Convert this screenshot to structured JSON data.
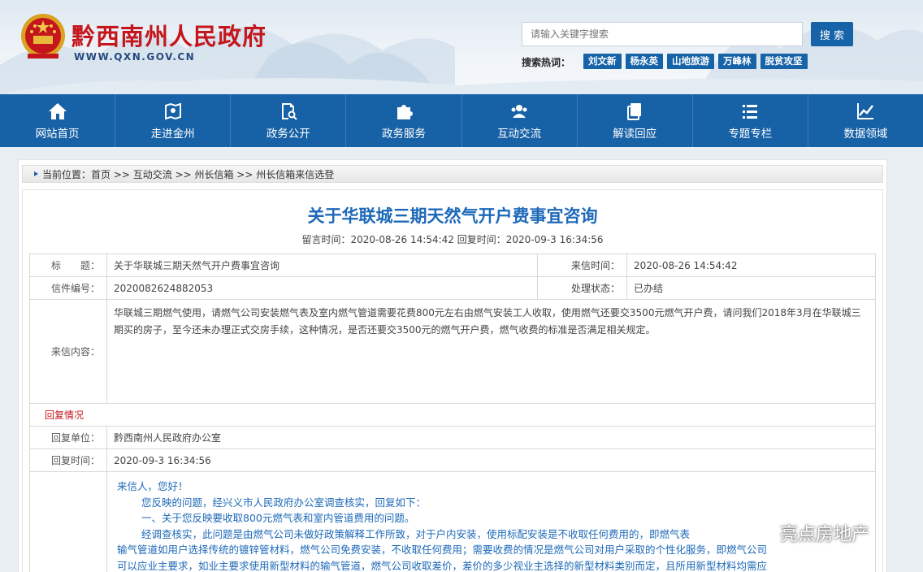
{
  "header": {
    "site_name": "黔西南州人民政府",
    "site_url": "WWW.QXN.GOV.CN",
    "search_placeholder": "请输入关键字搜索",
    "search_button": "搜 索",
    "hot_label": "搜索热词：",
    "hot_tags": [
      "刘文新",
      "杨永英",
      "山地旅游",
      "万峰林",
      "脱贫攻坚"
    ]
  },
  "nav": [
    {
      "label": "网站首页",
      "icon": "home-icon"
    },
    {
      "label": "走进金州",
      "icon": "map-pin-icon"
    },
    {
      "label": "政务公开",
      "icon": "document-search-icon"
    },
    {
      "label": "政务服务",
      "icon": "puzzle-icon"
    },
    {
      "label": "互动交流",
      "icon": "users-icon"
    },
    {
      "label": "解读回应",
      "icon": "copy-icon"
    },
    {
      "label": "专题专栏",
      "icon": "list-icon"
    },
    {
      "label": "数据领域",
      "icon": "chart-icon"
    }
  ],
  "breadcrumb": {
    "prefix": "当前位置：",
    "path": "首页 >> 互动交流 >> 州长信箱 >> 州长信箱来信选登"
  },
  "letter": {
    "title": "关于华联城三期天然气开户费事宜咨询",
    "meta": "留言时间：2020-08-26 14:54:42 回复时间：2020-09-3 16:34:56",
    "rows": {
      "title_label": "标　　题：",
      "title_value": "关于华联城三期天然气开户费事宜咨询",
      "recv_time_label": "来信时间：",
      "recv_time_value": "2020-08-26 14:54:42",
      "number_label": "信件编号：",
      "number_value": "2020082624882053",
      "status_label": "处理状态：",
      "status_value": "已办结",
      "content_label": "来信内容：",
      "content_value": "华联城三期燃气使用，请燃气公司安装燃气表及室内燃气管道需要花费800元左右由燃气安装工人收取，使用燃气还要交3500元燃气开户费，请问我们2018年3月在华联城三期买的房子，至今还未办理正式交房手续，这种情况，是否还要交3500元的燃气开户费，燃气收费的标准是否满足相关规定。",
      "reply_section": "回复情况",
      "reply_unit_label": "回复单位：",
      "reply_unit_value": "黔西南州人民政府办公室",
      "reply_time_label": "回复时间：",
      "reply_time_value": "2020-09-3 16:34:56"
    },
    "reply": {
      "greeting": "来信人，您好！",
      "p1": "您反映的问题，经兴义市人民政府办公室调查核实，回复如下：",
      "p2": "一、关于您反映要收取800元燃气表和室内管道费用的问题。",
      "p3a": "经调查核实，此问题是由燃气公司未做好政策解释工作所致，对于户内安装，使用标配安装是不收取任何费用的，即燃气表",
      "p3b": "输气管道如用户选择传统的镀锌管材料，燃气公司免费安装，不收取任何费用；需要收费的情况是燃气公司对用户采取的个性化服务，即燃气公司",
      "p3c": "可以应业主要求，如业主要求使用新型材料的输气管道，燃气公司收取差价，差价的多少视业主选择的新型材料类别而定，且所用新型材料均需应"
    }
  },
  "watermark": "亮点房地产"
}
